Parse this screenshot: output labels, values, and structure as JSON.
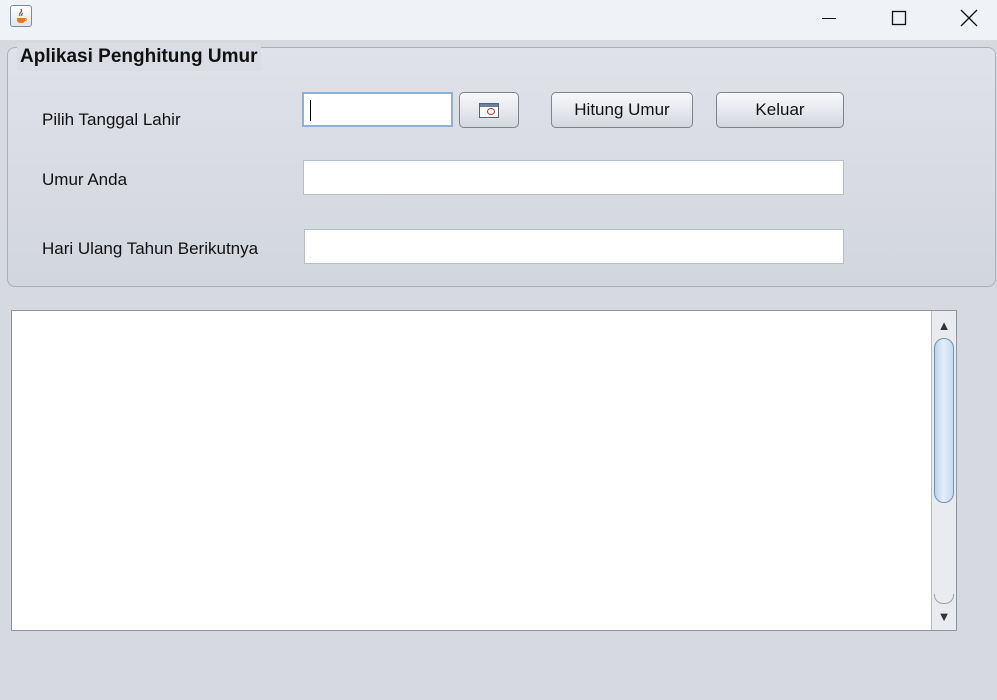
{
  "window": {
    "icon": "java-cup-icon",
    "controls": [
      "minimize-icon",
      "maximize-icon",
      "close-icon"
    ]
  },
  "form": {
    "title": "Aplikasi Penghitung Umur",
    "labels": {
      "birth_date": "Pilih Tanggal Lahir",
      "age": "Umur Anda",
      "next_birthday": "Hari Ulang Tahun Berikutnya"
    },
    "birth_date_value": "",
    "age_value": "",
    "next_birthday_value": "",
    "buttons": {
      "calculate": "Hitung Umur",
      "exit": "Keluar",
      "calendar_icon": "calendar-icon"
    }
  },
  "output": {
    "text": ""
  },
  "colors": {
    "window_bg": "#d6d9df",
    "titlebar_bg": "#eff2f7",
    "focus_border": "#8fb0d4",
    "scroll_thumb": "#bcd3ec"
  }
}
